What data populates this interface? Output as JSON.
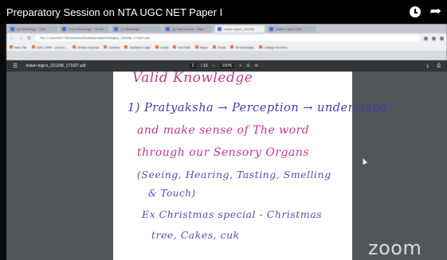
{
  "video": {
    "title": "Preparatory Session on NTA UGC NET Paper I",
    "watermark": "zoom"
  },
  "browser": {
    "tabs": [
      {
        "label": "(5) WhatsApp - Zoho",
        "active": false
      },
      {
        "label": "Prep Messenger - Group",
        "active": false
      },
      {
        "label": "(7) Whatsapp",
        "active": false
      },
      {
        "label": "(4) Discussions - New",
        "active": false
      },
      {
        "label": "Indian-logics_231208",
        "active": true
      },
      {
        "label": "Indian Logics UGC",
        "active": false
      }
    ],
    "address": "File  C:/Users/91778/OneDrive/Desktop/Indian%20logics_231208_171627.pdf",
    "bookmarks": [
      "New Tab",
      "Zoho CRM - Lead D...",
      "Veritas Express",
      "Uniwise",
      "HubSpot Login",
      "Gmail",
      "YouTube",
      "Maps",
      "Gmail",
      "Zfi Whatsapp",
      "College Archives"
    ]
  },
  "pdf": {
    "menu_icon": "hamburger-icon",
    "file_name": "Indian-logics_231208_171627.pdf",
    "page_current": "2",
    "page_total": "/ 15",
    "zoom": "100%",
    "fit_icon": "fit-page-icon",
    "rotate_icon": "rotate-icon",
    "download_icon": "download-icon",
    "print_icon": "print-icon"
  },
  "notes": {
    "line1": "Valid  Knowledge",
    "line2a": "1) Pratyaksha → Perception → understand",
    "line3": "and  make  sense  of  The  word",
    "line4": "through  our  Sensory  Organs",
    "line5": "(Seeing,  Hearing,  Tasting,  Smelling",
    "line6": "&  Touch)",
    "line7": "Ex  Christmas  special  -  Christmas",
    "line8": "tree,  Cakes,  cuk"
  },
  "colors": {
    "pink_ink": "#c0398f",
    "blue_ink": "#3d3fb0",
    "toolbar": "#323639"
  }
}
